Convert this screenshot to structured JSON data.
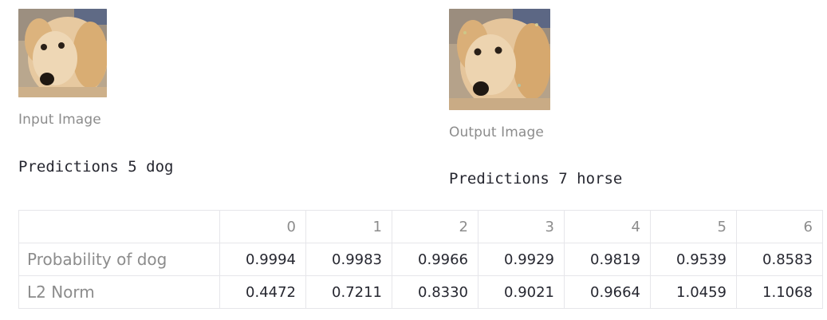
{
  "input": {
    "caption": "Input Image",
    "prediction": "Predictions 5 dog"
  },
  "output": {
    "caption": "Output Image",
    "prediction": "Predictions 7 horse"
  },
  "table": {
    "columns": [
      "",
      "0",
      "1",
      "2",
      "3",
      "4",
      "5",
      "6"
    ],
    "rows": [
      {
        "label": "Probability of dog",
        "values": [
          "0.9994",
          "0.9983",
          "0.9966",
          "0.9929",
          "0.9819",
          "0.9539",
          "0.8583"
        ]
      },
      {
        "label": "L2 Norm",
        "values": [
          "0.4472",
          "0.7211",
          "0.8330",
          "0.9021",
          "0.9664",
          "1.0459",
          "1.1068"
        ]
      }
    ]
  }
}
